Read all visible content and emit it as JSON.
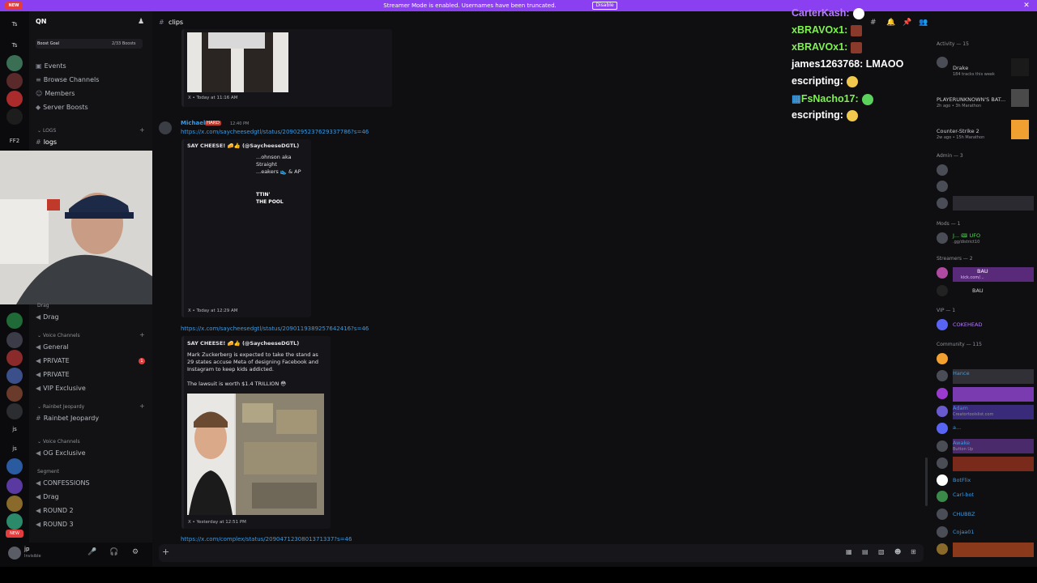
{
  "banner": {
    "text": "Streamer Mode is enabled. Usernames have been truncated.",
    "disable": "Disable",
    "close": "✕",
    "new": "NEW"
  },
  "rail": {
    "items": [
      "Ts",
      "Ts",
      "FF2",
      "js",
      "js",
      "NEW"
    ]
  },
  "server": {
    "name": "QN",
    "boost_goal": "Boost Goal",
    "boosts": "2/33 Boosts",
    "nav": [
      "Events",
      "Browse Channels",
      "Members",
      "Server Boosts"
    ],
    "category_logs": "LOGS",
    "logs_channel": "logs",
    "drag_top": "Drag",
    "voice_category": "Voice Channels",
    "voice": [
      "General",
      "PRIVATE",
      "PRIVATE",
      "VIP Exclusive"
    ],
    "private_badge": "1",
    "rainbet_category": "Rainbet Jeopardy",
    "rainbet_channel": "Rainbet Jeopardy",
    "voice_category2": "Voice Channels",
    "og": "OG Exclusive",
    "segment": "Segment",
    "segment_channels": [
      "CONFESSIONS",
      "Drag",
      "ROUND 2",
      "ROUND 3"
    ]
  },
  "user": {
    "name": "jp",
    "status": "Invisible"
  },
  "channel": {
    "name": "clips"
  },
  "messages": {
    "msg1_footer": "X • Today at 11:16 AM",
    "author": "Michael",
    "author_tag": "HARD",
    "author_time": "12:40 PM",
    "link1": "https://x.com/saycheesedgtl/status/2090295237629337786?s=46",
    "embed1_title": "SAY CHEESE! 🧀👍 (@SaycheeseDGTL)",
    "embed1_text": "...ohnson aka Straight\n...eakers 👟 & AP",
    "embed1_img_text": "TTIN'\nTHE POOL",
    "embed1_footer": "X • Today at 12:29 AM",
    "link2": "https://x.com/saycheesedgtl/status/2090119389257642416?s=46",
    "embed2_title": "SAY CHEESE! 🧀👍 (@SaycheeseDGTL)",
    "embed2_text": "Mark Zuckerberg is expected to take the stand as 29 states accuse Meta of designing Facebook and Instagram to keep kids addicted.",
    "embed2_text2": "The lawsuit is worth $1.4 TRILLION 😳",
    "embed2_footer": "X • Yesterday at 12:51 PM",
    "link3": "https://x.com/complex/status/2090471230801371337?s=46"
  },
  "chat_overlay": [
    {
      "name": "CarterKash:",
      "msg": "",
      "color": "#b57cff"
    },
    {
      "name": "xBRAVOx1:",
      "msg": "",
      "color": "#7ef24e"
    },
    {
      "name": "xBRAVOx1:",
      "msg": "",
      "color": "#7ef24e"
    },
    {
      "name": "james1263768:",
      "msg": "LMAOO",
      "color": "#ffffff"
    },
    {
      "name": "escripting:",
      "msg": "",
      "color": "#ffffff"
    },
    {
      "name": "FsNacho17:",
      "msg": "",
      "color": "#7ef24e"
    },
    {
      "name": "escripting:",
      "msg": "",
      "color": "#ffffff"
    }
  ],
  "search": {
    "placeholder": "Search QN"
  },
  "members": {
    "activity_header": "Activity — 15",
    "activity": [
      {
        "name": "Drake",
        "sub": "184 tracks this week"
      },
      {
        "name": "PLAYERUNKNOWN'S BAT...",
        "sub": "2h ago • 3h Marathon"
      },
      {
        "name": "Counter-Strike 2",
        "sub": "2w ago • 15h Marathon"
      }
    ],
    "admin_header": "Admin — 3",
    "mods_header": "Mods — 1",
    "mods": [
      {
        "name": "J... 🎟 UFO",
        "sub": ".gg/district10"
      }
    ],
    "streamers_header": "Streamers — 2",
    "streamers": [
      {
        "name": "⚡ BAU",
        "sub": "kick.com/...",
        "tag": "BAU"
      },
      {
        "name": "⚡ BAU",
        "sub": "",
        "tag": "BAU"
      }
    ],
    "vip_header": "VIP — 1",
    "vip": [
      {
        "name": "COKEHEAD"
      }
    ],
    "community_header": "Community — 115",
    "community": [
      {
        "name": "B",
        "sub": ""
      },
      {
        "name": "Hance",
        "sub": "SSB"
      },
      {
        "name": "—",
        "sub": ""
      },
      {
        "name": "Adam",
        "sub": "Creatortoolslist.com"
      },
      {
        "name": "a...",
        "sub": "VIBE"
      },
      {
        "name": "Awake",
        "sub": "Button Up"
      },
      {
        "name": "b...",
        "sub": ""
      },
      {
        "name": "BotFlix",
        "sub": "APP"
      },
      {
        "name": "Carl-bot",
        "sub": "APP"
      },
      {
        "name": "CHUBBZ",
        "sub": "GODCH"
      },
      {
        "name": "Cojaa01",
        "sub": ""
      }
    ]
  }
}
